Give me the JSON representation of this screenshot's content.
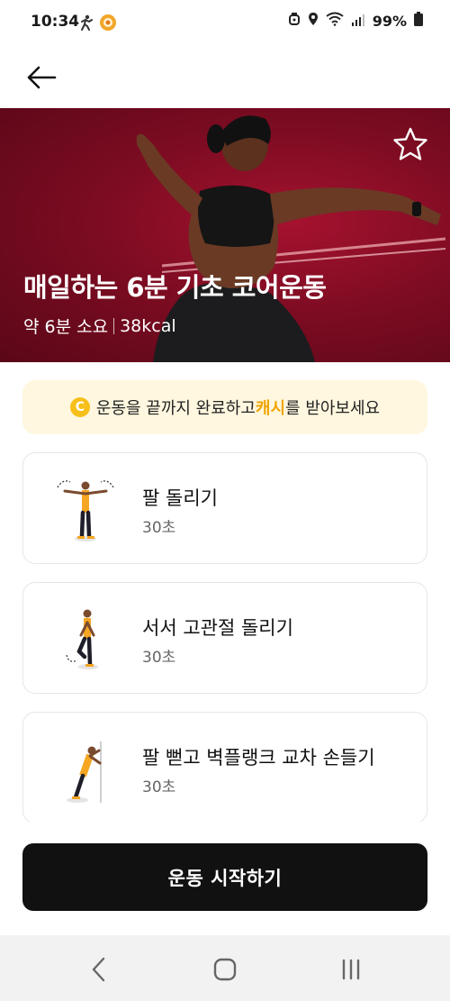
{
  "status_bar": {
    "time": "10:34",
    "battery": "99%"
  },
  "app_bar": {
    "back_icon": "arrow-left-icon"
  },
  "hero": {
    "title": "매일하는 6분 기초 코어운동",
    "duration": "약 6분 소요",
    "calories": "38kcal",
    "favorite_icon": "star-outline-icon",
    "background_color": "#8b0d26"
  },
  "promo": {
    "coin_glyph": "C",
    "text_before": "운동을 끝까지 완료하고 ",
    "highlight": "캐시",
    "text_after": "를 받아보세요",
    "highlight_color": "#f0a400",
    "background_color": "#fff7df"
  },
  "exercises": [
    {
      "name": "팔 돌리기",
      "duration": "30초"
    },
    {
      "name": "서서 고관절 돌리기",
      "duration": "30초"
    },
    {
      "name": "팔 뻗고 벽플랭크 교차 손들기",
      "duration": "30초"
    }
  ],
  "start_button": {
    "label": "운동 시작하기",
    "background_color": "#111111"
  },
  "nav_bar": {
    "back_icon": "chevron-left-icon",
    "home_icon": "home-square-icon",
    "recents_icon": "recents-lines-icon"
  }
}
